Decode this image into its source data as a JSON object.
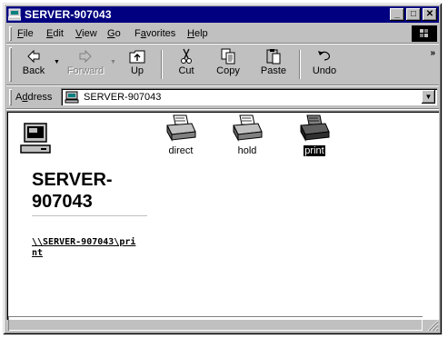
{
  "window": {
    "title": "SERVER-907043",
    "controls": {
      "minimize": "_",
      "maximize": "□",
      "close": "✕"
    }
  },
  "menu": {
    "items": [
      {
        "prefix": "",
        "key": "F",
        "rest": "ile"
      },
      {
        "prefix": "",
        "key": "E",
        "rest": "dit"
      },
      {
        "prefix": "",
        "key": "V",
        "rest": "iew"
      },
      {
        "prefix": "",
        "key": "G",
        "rest": "o"
      },
      {
        "prefix": "F",
        "key": "a",
        "rest": "vorites"
      },
      {
        "prefix": "",
        "key": "H",
        "rest": "elp"
      }
    ]
  },
  "toolbar": {
    "back": "Back",
    "forward": "Forward",
    "up": "Up",
    "cut": "Cut",
    "copy": "Copy",
    "paste": "Paste",
    "undo": "Undo",
    "more": "»"
  },
  "address": {
    "label_key": "d",
    "label_prefix": "A",
    "label_rest": "dress",
    "value": "SERVER-907043"
  },
  "left_panel": {
    "title": "SERVER-907043",
    "title_line1": "SERVER-",
    "title_line2": "907043",
    "link": "\\\\SERVER-907043\\print"
  },
  "files": [
    {
      "name": "direct",
      "selected": false
    },
    {
      "name": "hold",
      "selected": false
    },
    {
      "name": "print",
      "selected": true
    }
  ],
  "status": {
    "text": ""
  }
}
